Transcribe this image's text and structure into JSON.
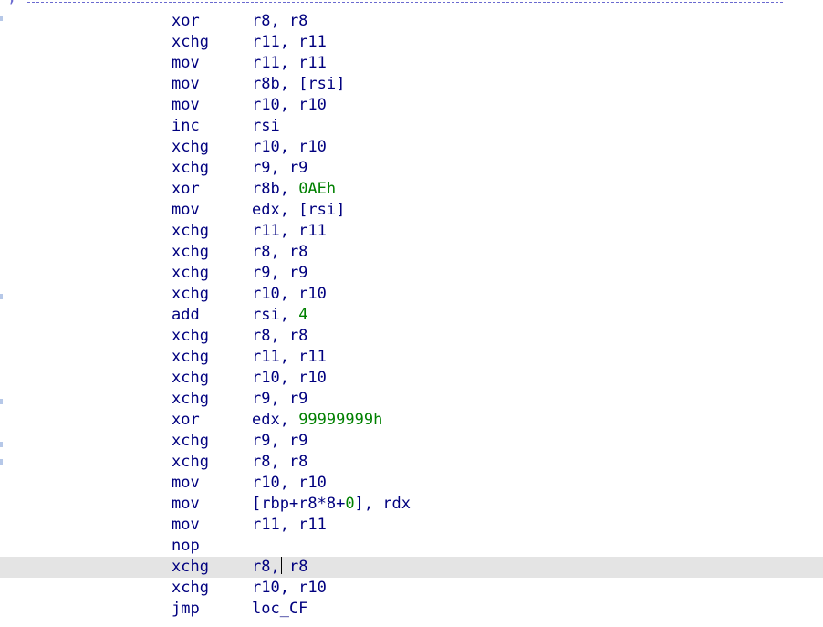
{
  "separator": {
    "prefix": ";"
  },
  "colors": {
    "code_text": "#00007f",
    "immediate_number": "#008000",
    "current_line_highlight": "#e4e4e4",
    "background": "#ffffff"
  },
  "listing": {
    "cursor_line_index": 26,
    "lines": [
      {
        "mnemonic": "xor",
        "operands": [
          {
            "t": "r8, r8"
          }
        ]
      },
      {
        "mnemonic": "xchg",
        "operands": [
          {
            "t": "r11, r11"
          }
        ]
      },
      {
        "mnemonic": "mov",
        "operands": [
          {
            "t": "r11, r11"
          }
        ]
      },
      {
        "mnemonic": "mov",
        "operands": [
          {
            "t": "r8b, [rsi]"
          }
        ]
      },
      {
        "mnemonic": "mov",
        "operands": [
          {
            "t": "r10, r10"
          }
        ]
      },
      {
        "mnemonic": "inc",
        "operands": [
          {
            "t": "rsi"
          }
        ]
      },
      {
        "mnemonic": "xchg",
        "operands": [
          {
            "t": "r10, r10"
          }
        ]
      },
      {
        "mnemonic": "xchg",
        "operands": [
          {
            "t": "r9, r9"
          }
        ]
      },
      {
        "mnemonic": "xor",
        "operands": [
          {
            "t": "r8b, "
          },
          {
            "t": "0AEh",
            "num": true
          }
        ]
      },
      {
        "mnemonic": "mov",
        "operands": [
          {
            "t": "edx, [rsi]"
          }
        ]
      },
      {
        "mnemonic": "xchg",
        "operands": [
          {
            "t": "r11, r11"
          }
        ]
      },
      {
        "mnemonic": "xchg",
        "operands": [
          {
            "t": "r8, r8"
          }
        ]
      },
      {
        "mnemonic": "xchg",
        "operands": [
          {
            "t": "r9, r9"
          }
        ]
      },
      {
        "mnemonic": "xchg",
        "operands": [
          {
            "t": "r10, r10"
          }
        ]
      },
      {
        "mnemonic": "add",
        "operands": [
          {
            "t": "rsi, "
          },
          {
            "t": "4",
            "num": true
          }
        ]
      },
      {
        "mnemonic": "xchg",
        "operands": [
          {
            "t": "r8, r8"
          }
        ]
      },
      {
        "mnemonic": "xchg",
        "operands": [
          {
            "t": "r11, r11"
          }
        ]
      },
      {
        "mnemonic": "xchg",
        "operands": [
          {
            "t": "r10, r10"
          }
        ]
      },
      {
        "mnemonic": "xchg",
        "operands": [
          {
            "t": "r9, r9"
          }
        ]
      },
      {
        "mnemonic": "xor",
        "operands": [
          {
            "t": "edx, "
          },
          {
            "t": "99999999h",
            "num": true
          }
        ]
      },
      {
        "mnemonic": "xchg",
        "operands": [
          {
            "t": "r9, r9"
          }
        ]
      },
      {
        "mnemonic": "xchg",
        "operands": [
          {
            "t": "r8, r8"
          }
        ]
      },
      {
        "mnemonic": "mov",
        "operands": [
          {
            "t": "r10, r10"
          }
        ]
      },
      {
        "mnemonic": "mov",
        "operands": [
          {
            "t": "[rbp+r8*8+"
          },
          {
            "t": "0",
            "num": true
          },
          {
            "t": "], rdx"
          }
        ]
      },
      {
        "mnemonic": "mov",
        "operands": [
          {
            "t": "r11, r11"
          }
        ]
      },
      {
        "mnemonic": "nop",
        "operands": []
      },
      {
        "mnemonic": "xchg",
        "operands": [
          {
            "t": "r8,"
          },
          {
            "caret": true
          },
          {
            "t": " r8"
          }
        ]
      },
      {
        "mnemonic": "xchg",
        "operands": [
          {
            "t": "r10, r10"
          }
        ]
      },
      {
        "mnemonic": "jmp",
        "operands": [
          {
            "t": "loc_CF"
          }
        ]
      }
    ]
  }
}
